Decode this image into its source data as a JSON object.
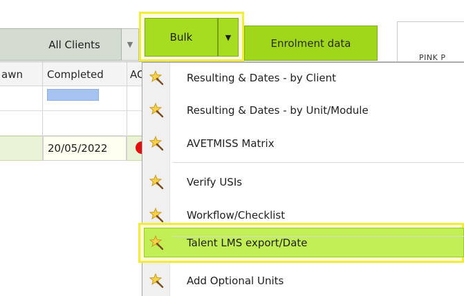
{
  "toolbar": {
    "all_clients_label": "All Clients",
    "bulk_label": "Bulk",
    "enrolment_label": "Enrolment data",
    "tab_label": "PINK P",
    "dropdown_arrow": "▼",
    "split_arrow": "▼"
  },
  "grid": {
    "columns": [
      "awn",
      "Completed",
      "AC"
    ],
    "rows": [
      {
        "completed": ""
      },
      {
        "completed": ""
      },
      {
        "completed": "20/05/2022"
      }
    ]
  },
  "menu": {
    "items": [
      {
        "label": "Resulting & Dates - by Client",
        "icon": "wand-icon"
      },
      {
        "label": "Resulting & Dates - by Unit/Module",
        "icon": "wand-icon"
      },
      {
        "label": "AVETMISS Matrix",
        "icon": "wand-icon"
      },
      {
        "label": "Verify USIs",
        "icon": "wand-icon"
      },
      {
        "label": "Workflow/Checklist",
        "icon": "wand-icon"
      },
      {
        "label": "Talent LMS export/Date",
        "icon": "wand-icon",
        "highlighted": true
      },
      {
        "label": "Add Optional Units",
        "icon": "wand-icon"
      }
    ]
  },
  "colors": {
    "accent_green": "#a6dd20",
    "highlight_yellow": "#f2ec3a",
    "status_red": "#e01010",
    "selected_cell_blue": "#a7c4f0"
  }
}
